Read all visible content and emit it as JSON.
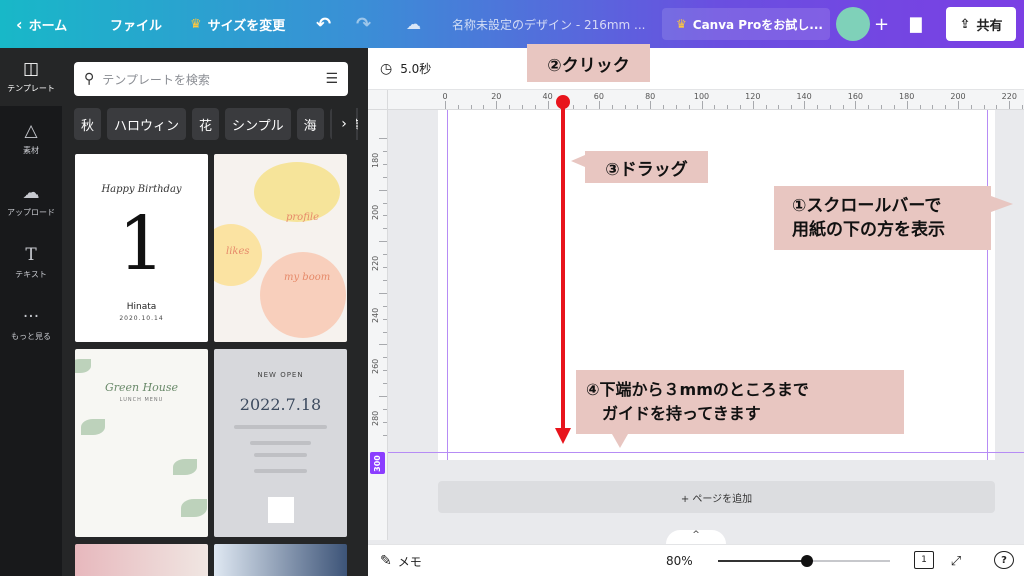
{
  "topbar": {
    "home": "ホーム",
    "file": "ファイル",
    "resize": "サイズを変更",
    "doc_title": "名称未設定のデザイン - 216mm ...",
    "pro": "Canva Proをお試し...",
    "share": "共有"
  },
  "rail": [
    {
      "label": "テンプレート",
      "icon": "template-icon"
    },
    {
      "label": "素材",
      "icon": "elements-icon"
    },
    {
      "label": "アップロード",
      "icon": "upload-icon"
    },
    {
      "label": "テキスト",
      "icon": "text-icon"
    },
    {
      "label": "もっと見る",
      "icon": "more-icon"
    }
  ],
  "panel": {
    "search_placeholder": "テンプレートを検索",
    "chips": [
      "秋",
      "ハロウィン",
      "花",
      "シンプル",
      "海",
      "写真"
    ],
    "templates": {
      "t1": {
        "heading": "Happy Birthday",
        "number": "1",
        "name": "Hinata",
        "date": "2020.10.14"
      },
      "t2": {
        "w1": "profile",
        "w2": "likes",
        "w3": "my boom"
      },
      "t3": {
        "title": "Green House",
        "subtitle": "LUNCH MENU"
      },
      "t4": {
        "open": "NEW OPEN",
        "date": "2022.7.18"
      }
    }
  },
  "editor": {
    "timer": "5.0秒",
    "ruler_h": [
      "0",
      "20",
      "40",
      "60",
      "80",
      "100",
      "120",
      "140",
      "160",
      "180",
      "200",
      "220"
    ],
    "ruler_v": [
      "180",
      "200",
      "220",
      "240",
      "260",
      "280"
    ],
    "guide_value": "300",
    "add_page": "+ ページを追加",
    "scroll_up": "^"
  },
  "bottombar": {
    "memo": "メモ",
    "zoom": "80%",
    "zoom_fraction": 0.52,
    "page_count": "1",
    "help": "?"
  },
  "annotations": {
    "click": "②クリック",
    "drag": "③ドラッグ",
    "scroll": "①スクロールバーで\n用紙の下の方を表示",
    "bottom": "④下端から３mmのところまで\n　ガイドを持ってきます"
  },
  "colors": {
    "accent": "#8b3dff",
    "arrow": "#e8141c",
    "callout": "#e8c6c1",
    "guide": "#b68cf5"
  }
}
